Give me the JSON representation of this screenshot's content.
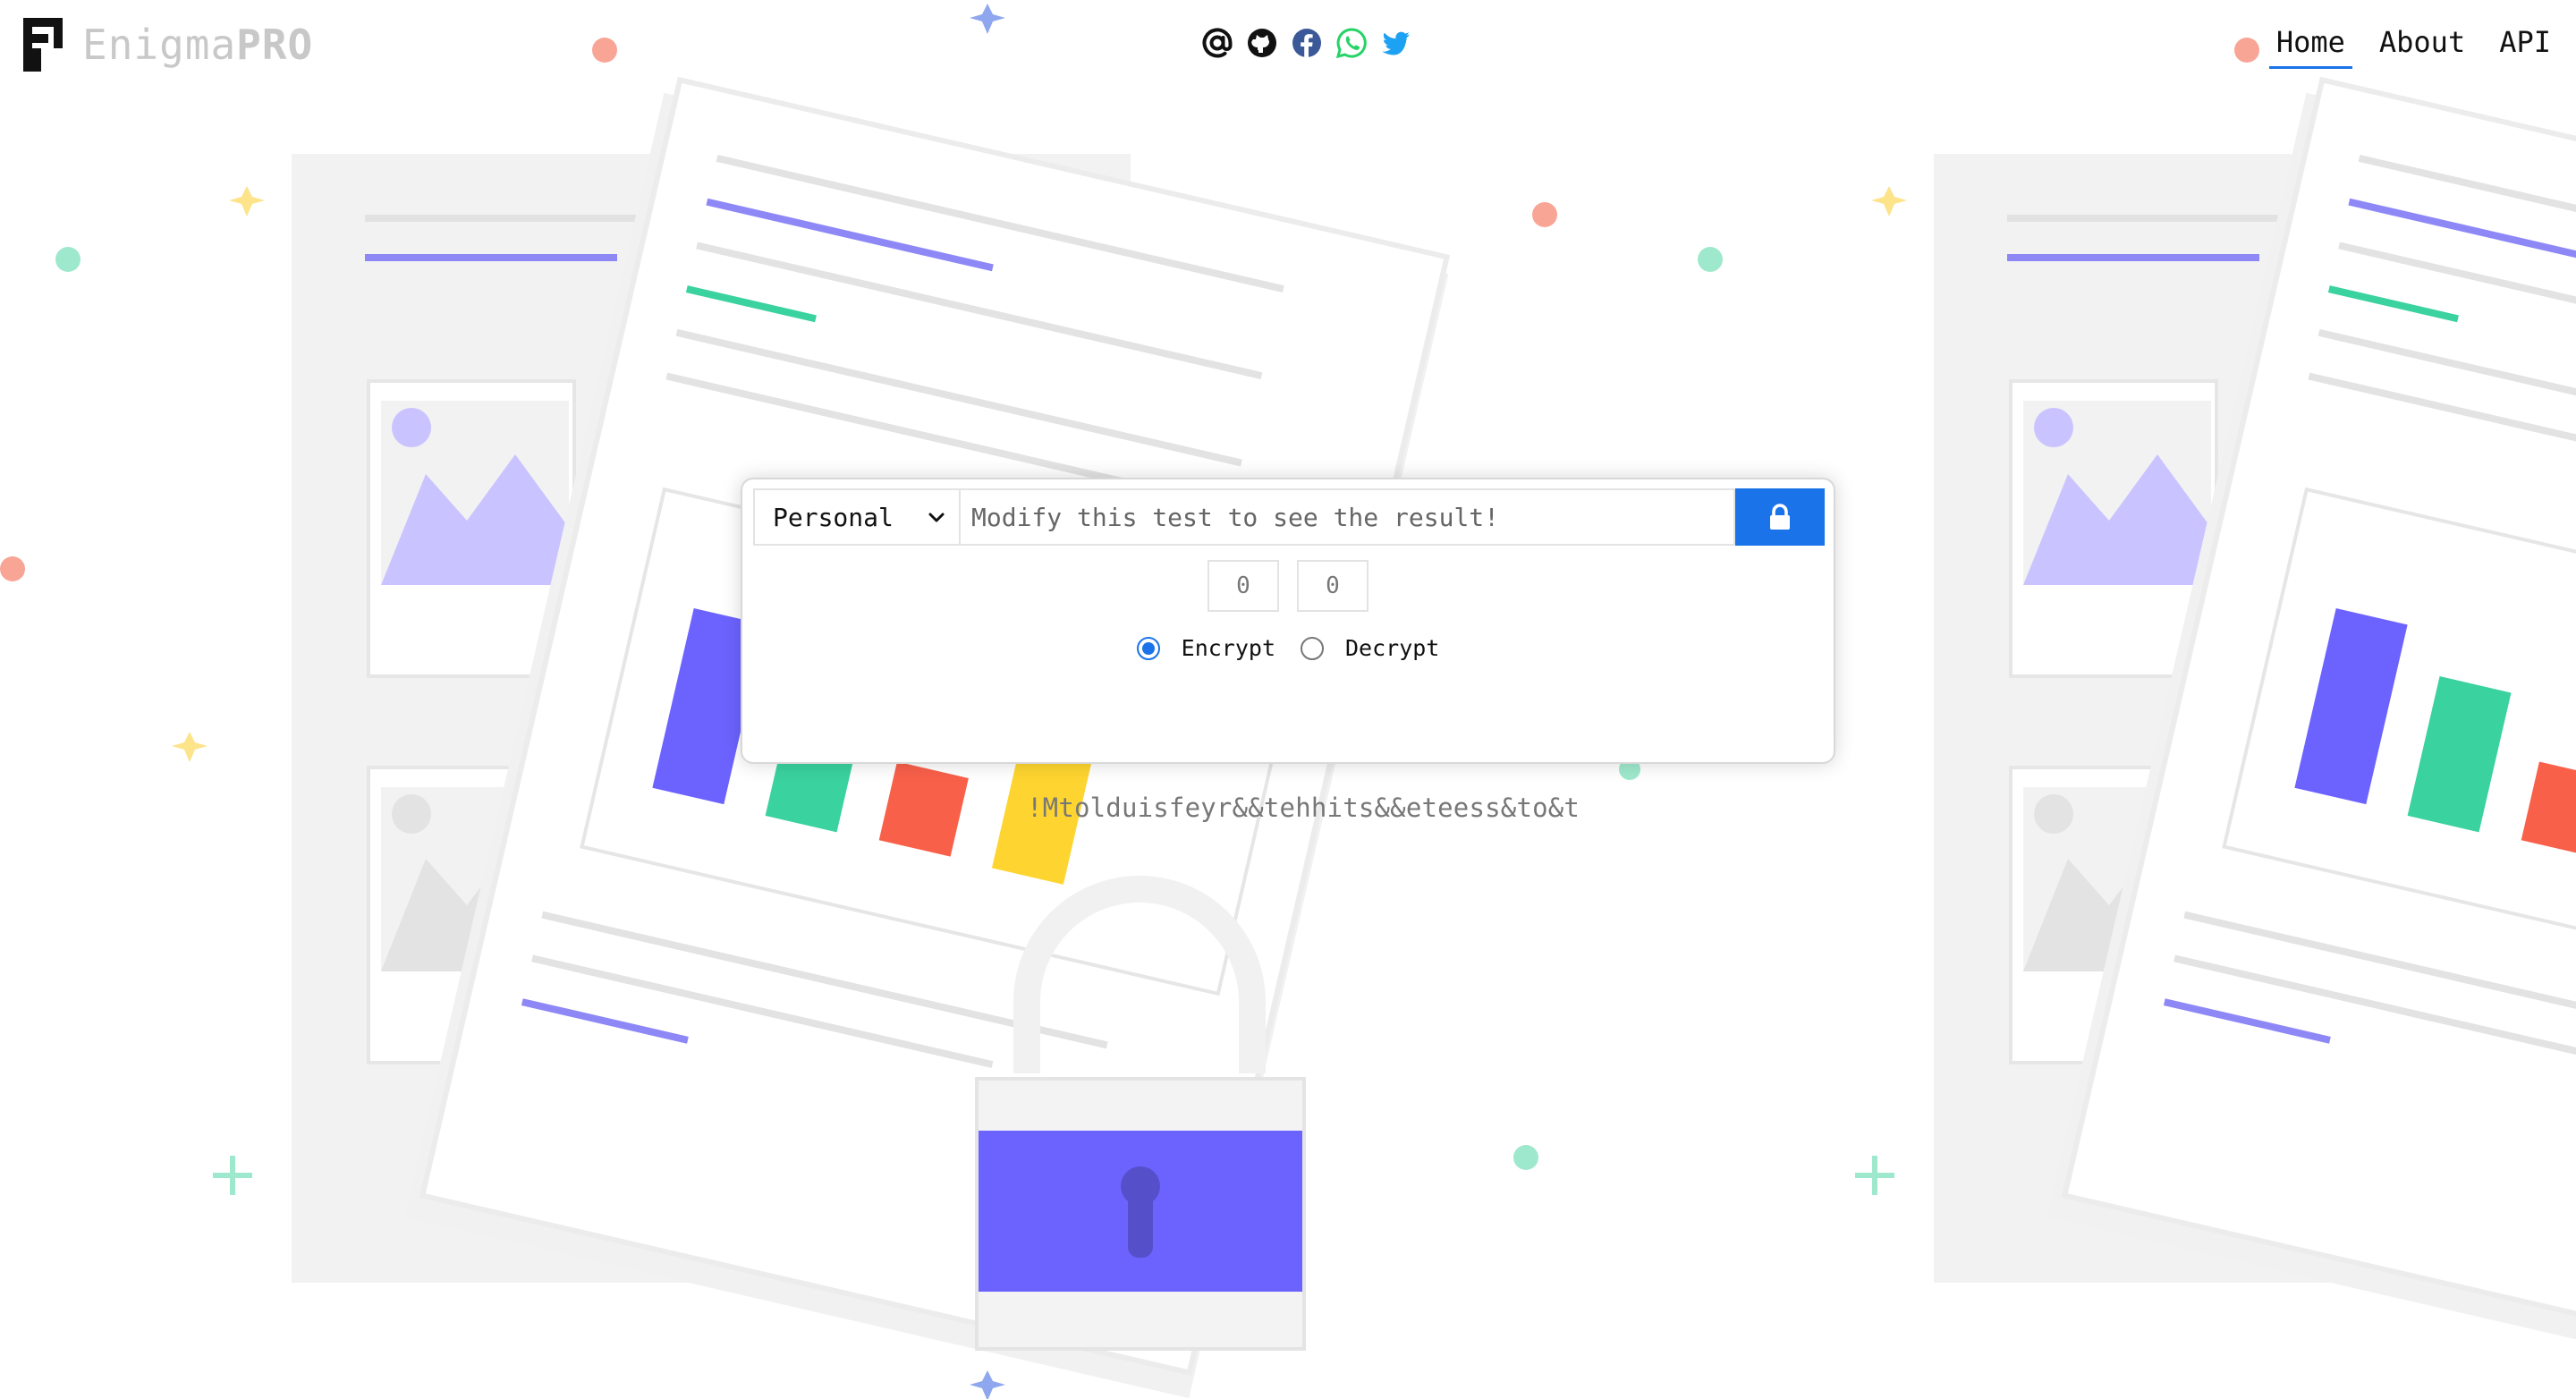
{
  "brand": {
    "name": "Enigma",
    "suffix": "PRO"
  },
  "header": {
    "socials": [
      "email-icon",
      "github-icon",
      "facebook-icon",
      "whatsapp-icon",
      "twitter-icon"
    ],
    "nav": [
      {
        "label": "Home",
        "active": true
      },
      {
        "label": "About",
        "active": false
      },
      {
        "label": "API",
        "active": false
      }
    ]
  },
  "encryptor": {
    "mode": "Personal",
    "input_placeholder": "Modify this test to see the result!",
    "counters": [
      "0",
      "0"
    ],
    "options": [
      {
        "label": "Encrypt",
        "selected": true
      },
      {
        "label": "Decrypt",
        "selected": false
      }
    ],
    "action_icon": "lock-icon",
    "result": "!Mtolduisfeyr&&tehhits&&eteess&to&t"
  },
  "colors": {
    "accent": "#1a73e8",
    "illustration_purple": "#6c63ff",
    "illustration_green": "#3ad29f",
    "illustration_red": "#f9604a",
    "illustration_yellow": "#fed530"
  }
}
